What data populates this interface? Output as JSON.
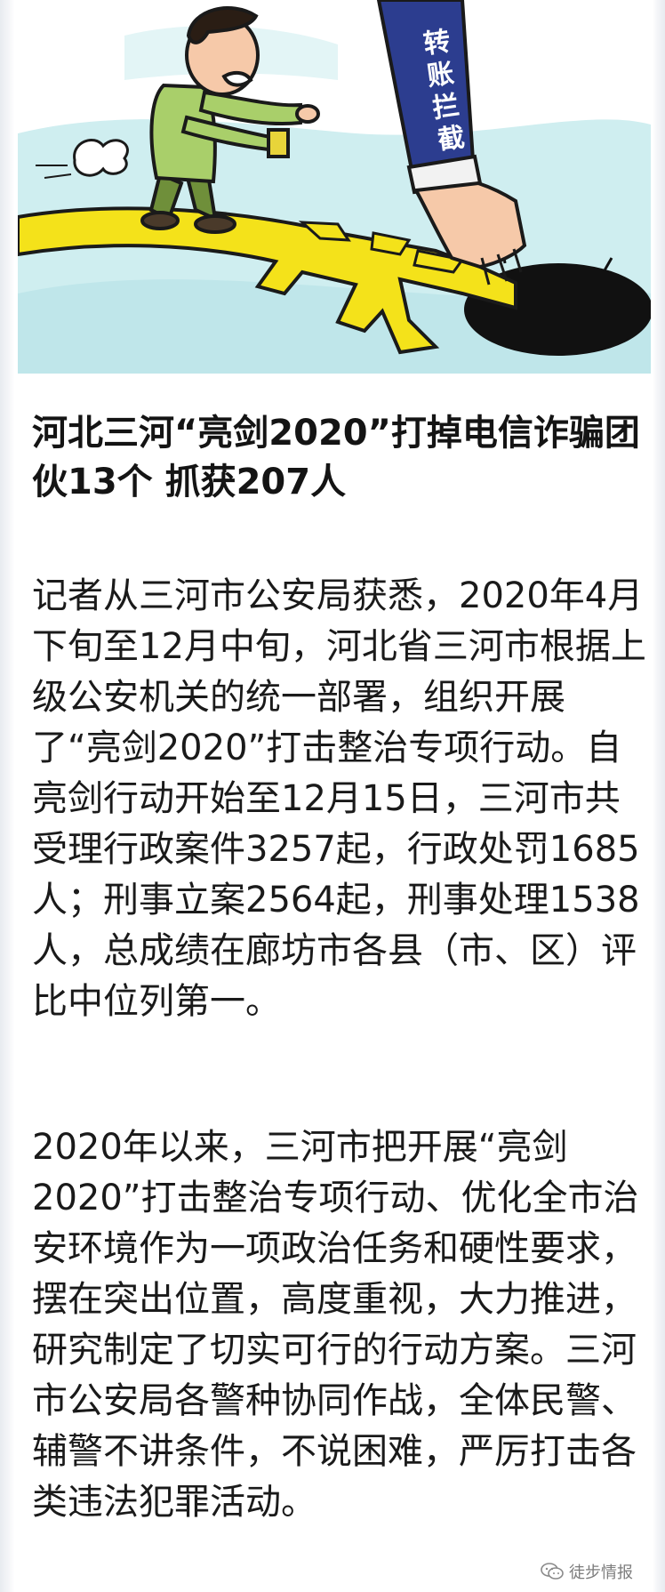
{
  "illustration": {
    "sign_text": "转账拦截"
  },
  "article": {
    "headline": "河北三河“亮剑2020”打掉电信诈骗团伙13个 抓获207人",
    "paragraphs": [
      "记者从三河市公安局获悉，2020年4月下旬至12月中旬，河北省三河市根据上级公安机关的统一部署，组织开展了“亮剑2020”打击整治专项行动。自亮剑行动开始至12月15日，三河市共受理行政案件3257起，行政处罚1685人；刑事立案2564起，刑事处理1538人，总成绩在廊坊市各县（市、区）评比中位列第一。",
      "2020年以来，三河市把开展“亮剑2020”打击整治专项行动、优化全市治安环境作为一项政治任务和硬性要求，摆在突出位置，高度重视，大力推进，研究制定了切实可行的行动方案。三河市公安局各警种协同作战，全体民警、辅警不讲条件，不说困难，严厉打击各类违法犯罪活动。"
    ]
  },
  "watermark": {
    "text": "徒步情报",
    "icon": "wechat-icon"
  },
  "colors": {
    "sky": "#cfeef0",
    "yuan_yellow": "#f4e21a",
    "sleeve_blue": "#2c3d8f",
    "shirt_green": "#a9cf6a",
    "pants_green": "#6f8f3a",
    "hole": "#111111"
  }
}
